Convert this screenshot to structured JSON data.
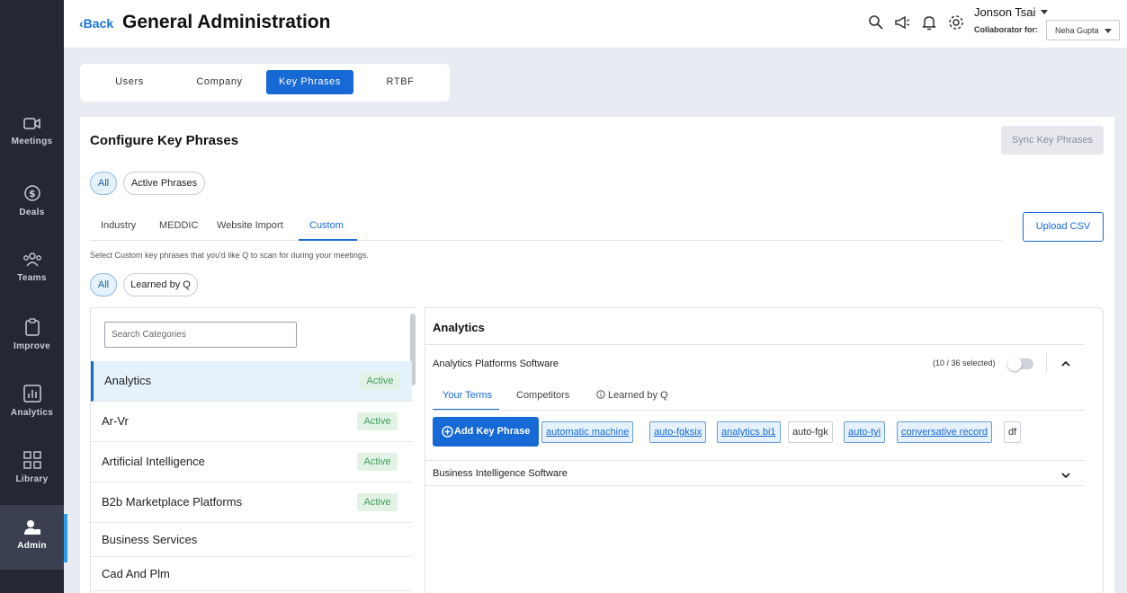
{
  "header": {
    "back_label": "Back",
    "title": "General Administration",
    "user_name": "Jonson Tsai",
    "collaborator_label": "Collaborator for:",
    "collaborator_value": "Neha Gupta"
  },
  "nav": {
    "items": [
      {
        "label": "Meetings",
        "icon": "video-icon"
      },
      {
        "label": "Deals",
        "icon": "dollar-icon"
      },
      {
        "label": "Teams",
        "icon": "team-icon"
      },
      {
        "label": "Improve",
        "icon": "clipboard-icon"
      },
      {
        "label": "Analytics",
        "icon": "bar-chart-icon"
      },
      {
        "label": "Library",
        "icon": "grid-icon"
      },
      {
        "label": "Admin",
        "icon": "admin-user-icon",
        "active": true
      }
    ]
  },
  "top_tabs": [
    {
      "label": "Users"
    },
    {
      "label": "Company"
    },
    {
      "label": "Key Phrases",
      "active": true
    },
    {
      "label": "RTBF"
    }
  ],
  "section": {
    "title": "Configure Key Phrases",
    "sync_label": "Sync Key Phrases",
    "filter_pills": [
      {
        "label": "All",
        "active": true
      },
      {
        "label": "Active Phrases"
      }
    ],
    "sub_tabs": [
      {
        "label": "Industry"
      },
      {
        "label": "MEDDIC"
      },
      {
        "label": "Website Import"
      },
      {
        "label": "Custom",
        "active": true
      }
    ],
    "upload_label": "Upload CSV",
    "helper_text": "Select Custom key phrases that you'd like Q to scan for during your meetings.",
    "source_pills": [
      {
        "label": "All",
        "active": true
      },
      {
        "label": "Learned by Q"
      }
    ]
  },
  "categories": {
    "search_placeholder": "Search Categories",
    "items": [
      {
        "name": "Analytics",
        "status": "Active",
        "selected": true
      },
      {
        "name": "Ar-Vr",
        "status": "Active"
      },
      {
        "name": "Artificial Intelligence",
        "status": "Active"
      },
      {
        "name": "B2b Marketplace Platforms",
        "status": "Active"
      },
      {
        "name": "Business Services",
        "status": ""
      },
      {
        "name": "Cad And Plm",
        "status": ""
      }
    ]
  },
  "detail": {
    "title": "Analytics",
    "groups": [
      {
        "title": "Analytics Platforms Software",
        "selected_count": "(10 / 36 selected)",
        "expanded": true,
        "tabs": [
          {
            "label": "Your Terms",
            "active": true
          },
          {
            "label": "Competitors"
          },
          {
            "label": "Learned by Q",
            "icon": "info-icon"
          }
        ],
        "add_label": "Add Key Phrase",
        "phrases": [
          {
            "text": "automatic machine",
            "selected": true
          },
          {
            "text": "auto-fgksix",
            "selected": true
          },
          {
            "text": "analytics bi1",
            "selected": true
          },
          {
            "text": "auto-fgk",
            "selected": false
          },
          {
            "text": "auto-tyi",
            "selected": true
          },
          {
            "text": "conversative record",
            "selected": true
          },
          {
            "text": "df",
            "selected": false
          }
        ]
      },
      {
        "title": "Business Intelligence Software",
        "expanded": false
      }
    ]
  }
}
